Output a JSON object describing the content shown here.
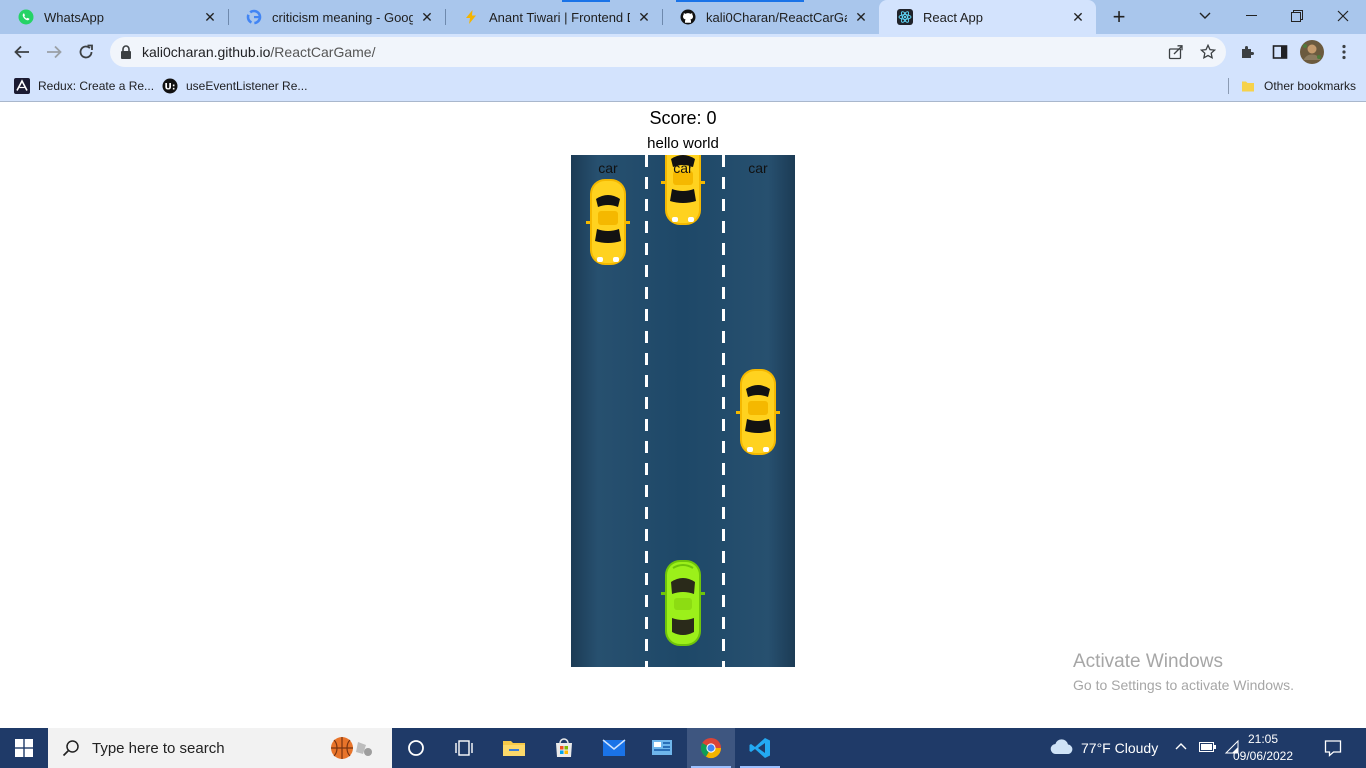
{
  "browser": {
    "tabs": [
      {
        "title": "WhatsApp",
        "icon": "whatsapp-icon",
        "active": false
      },
      {
        "title": "criticism meaning - Google S",
        "icon": "google-icon",
        "active": false
      },
      {
        "title": "Anant Tiwari | Frontend Deve",
        "icon": "bolt-icon",
        "active": false
      },
      {
        "title": "kali0Charan/ReactCarGame: ",
        "icon": "github-icon",
        "active": false
      },
      {
        "title": "React App",
        "icon": "react-icon",
        "active": true
      }
    ],
    "new_tab": "+",
    "address": {
      "host": "kali0charan.github.io",
      "path": "/ReactCarGame/"
    },
    "bookmarks": [
      {
        "label": "Redux: Create a Re...",
        "icon": "freecodecamp-icon"
      },
      {
        "label": "useEventListener Re...",
        "icon": "usehooks-icon"
      }
    ],
    "other_bookmarks": "Other bookmarks"
  },
  "game": {
    "score_text": "Score: 0",
    "message": "hello world",
    "enemy_labels": [
      "car",
      "car",
      "car"
    ],
    "colors": {
      "road": "#1e4868",
      "enemy_car": "#ffd21f",
      "player_car": "#9cf01a",
      "lane_line": "#ffffff"
    }
  },
  "watermark": {
    "title": "Activate Windows",
    "subtitle": "Go to Settings to activate Windows."
  },
  "taskbar": {
    "search_placeholder": "Type here to search",
    "weather": "77°F  Cloudy",
    "time": "21:05",
    "date": "09/06/2022"
  }
}
